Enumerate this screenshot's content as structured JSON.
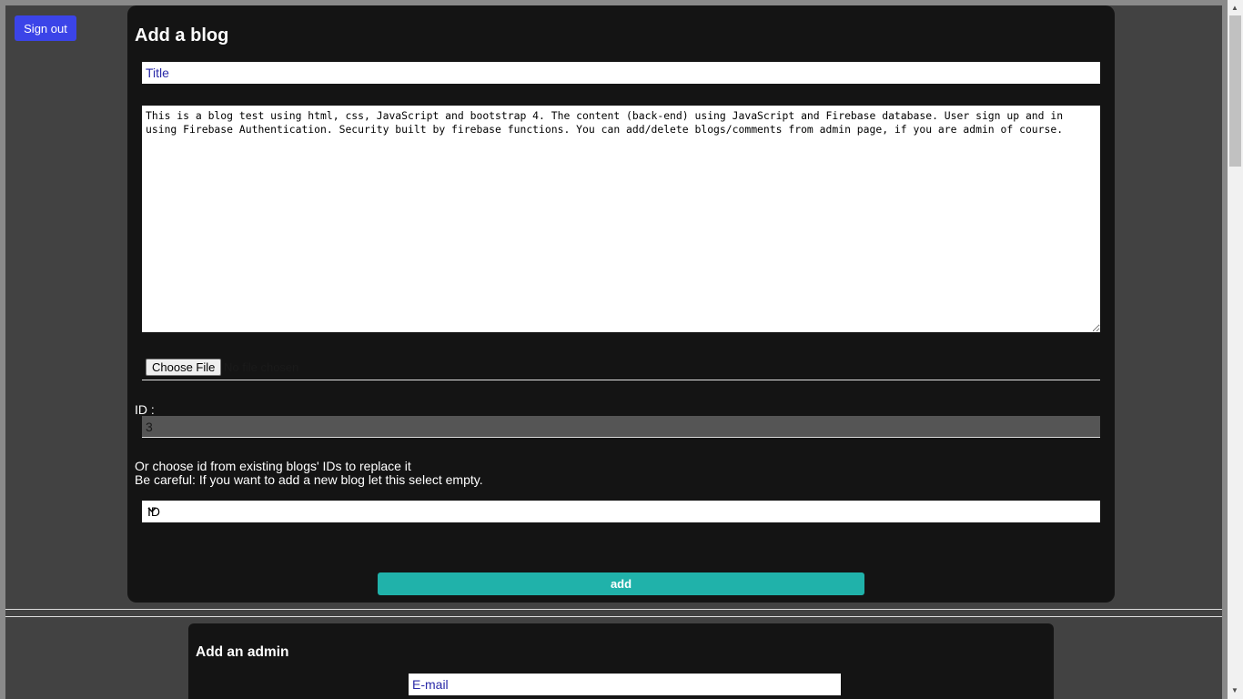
{
  "header": {
    "signout_label": "Sign out"
  },
  "blog_form": {
    "heading": "Add a blog",
    "title_placeholder": "Title",
    "content_value": "This is a blog test using html, css, JavaScript and bootstrap 4. The content (back-end) using JavaScript and Firebase database. User sign up and in using Firebase Authentication. Security built by firebase functions. You can add/delete blogs/comments from admin page, if you are admin of course.",
    "file_button_label": "Choose File",
    "file_status": "No file chosen",
    "id_label": "ID :",
    "id_value": "3",
    "note_line1": "Or choose id from existing blogs' IDs to replace it",
    "note_line2": "Be careful: If you want to add a new blog let this select empty.",
    "select_value": "ID",
    "add_label": "add"
  },
  "admin_form": {
    "heading": "Add an admin",
    "email_placeholder": "E-mail"
  },
  "colors": {
    "accent_blue": "#3b44e8",
    "accent_teal": "#20b2aa",
    "card_bg": "#141414",
    "page_bg": "#424242"
  }
}
